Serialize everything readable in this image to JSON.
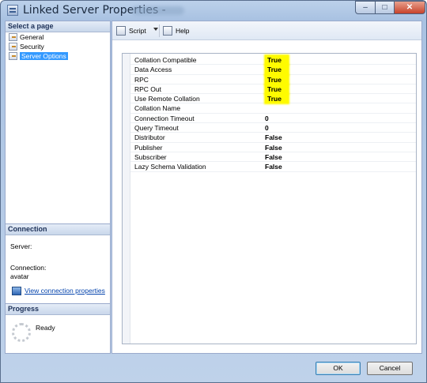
{
  "window": {
    "title": "Linked Server Properties - "
  },
  "left": {
    "select_page_header": "Select a page",
    "pages": [
      {
        "label": "General",
        "icon": "page-icon"
      },
      {
        "label": "Security",
        "icon": "page-icon"
      },
      {
        "label": "Server Options",
        "icon": "page-icon",
        "selected": true
      }
    ],
    "connection": {
      "header": "Connection",
      "server_label": "Server:",
      "connection_label": "Connection:",
      "connection_value": "avatar",
      "view_link": "View connection properties"
    },
    "progress": {
      "header": "Progress",
      "status": "Ready"
    }
  },
  "toolbar": {
    "script_label": "Script",
    "help_label": "Help"
  },
  "options": [
    {
      "name": "Collation Compatible",
      "value": "True",
      "highlighted": true
    },
    {
      "name": "Data Access",
      "value": "True",
      "highlighted": true
    },
    {
      "name": "RPC",
      "value": "True",
      "highlighted": true
    },
    {
      "name": "RPC Out",
      "value": "True",
      "highlighted": true
    },
    {
      "name": "Use Remote Collation",
      "value": "True",
      "highlighted": true
    },
    {
      "name": "Collation Name",
      "value": ""
    },
    {
      "name": "Connection Timeout",
      "value": "0"
    },
    {
      "name": "Query Timeout",
      "value": "0"
    },
    {
      "name": "Distributor",
      "value": "False"
    },
    {
      "name": "Publisher",
      "value": "False"
    },
    {
      "name": "Subscriber",
      "value": "False"
    },
    {
      "name": "Lazy Schema Validation",
      "value": "False"
    }
  ],
  "buttons": {
    "ok": "OK",
    "cancel": "Cancel"
  },
  "colors": {
    "selection": "#3399ff",
    "highlight": "#fffb00"
  }
}
